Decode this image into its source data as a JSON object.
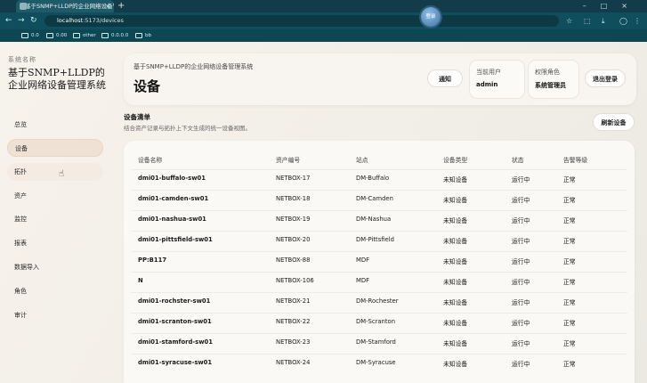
{
  "browser": {
    "tab_title": "基于SNMP+LLDP的企业网络设备管理系统",
    "tab_close": "×",
    "new_tab": "+",
    "url_host": "localhost",
    "url_path": ":5173/devices",
    "profile_label": "登录",
    "bookmarks": [
      "0.0",
      "0.00",
      "other",
      "0.0.0.0",
      "bb"
    ]
  },
  "sidebar": {
    "system_label": "系统名称",
    "system_title": "基于SNMP+LLDP的企业网络设备管理系统",
    "nav": [
      "总览",
      "设备",
      "拓扑",
      "资产",
      "监控",
      "报表",
      "数据导入",
      "角色",
      "审计"
    ],
    "active": "设备"
  },
  "header": {
    "subtitle": "基于SNMP+LLDP的企业网络设备管理系统",
    "title": "设备",
    "notify_button": "通知",
    "current_user_label": "当前用户",
    "current_user": "admin",
    "role_label": "权限角色",
    "role": "系统管理员",
    "logout_button": "退出登录"
  },
  "device_list": {
    "title": "设备清单",
    "description": "结合资产记录与拓扑上下文生成的统一设备视图。",
    "refresh_button": "刷新设备",
    "columns": [
      "设备名称",
      "资产编号",
      "站点",
      "设备类型",
      "状态",
      "告警等级"
    ],
    "rows": [
      [
        "dmi01-buffalo-sw01",
        "NETBOX-17",
        "DM-Buffalo",
        "未知设备",
        "运行中",
        "正常"
      ],
      [
        "dmi01-camden-sw01",
        "NETBOX-18",
        "DM-Camden",
        "未知设备",
        "运行中",
        "正常"
      ],
      [
        "dmi01-nashua-sw01",
        "NETBOX-19",
        "DM-Nashua",
        "未知设备",
        "运行中",
        "正常"
      ],
      [
        "dmi01-pittsfield-sw01",
        "NETBOX-20",
        "DM-Pittsfield",
        "未知设备",
        "运行中",
        "正常"
      ],
      [
        "PP:B117",
        "NETBOX-88",
        "MDF",
        "未知设备",
        "运行中",
        "正常"
      ],
      [
        "N",
        "NETBOX-106",
        "MDF",
        "未知设备",
        "运行中",
        "正常"
      ],
      [
        "dmi01-rochster-sw01",
        "NETBOX-21",
        "DM-Rochester",
        "未知设备",
        "运行中",
        "正常"
      ],
      [
        "dmi01-scranton-sw01",
        "NETBOX-22",
        "DM-Scranton",
        "未知设备",
        "运行中",
        "正常"
      ],
      [
        "dmi01-stamford-sw01",
        "NETBOX-23",
        "DM-Stamford",
        "未知设备",
        "运行中",
        "正常"
      ],
      [
        "dmi01-syracuse-sw01",
        "NETBOX-24",
        "DM-Syracuse",
        "未知设备",
        "运行中",
        "正常"
      ]
    ]
  }
}
